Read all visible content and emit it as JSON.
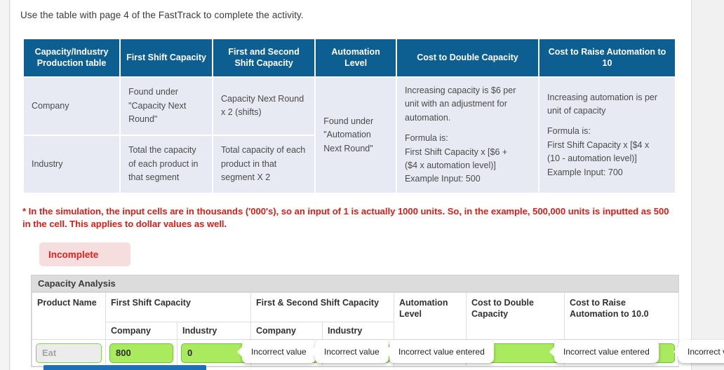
{
  "intro": "Use the table with page 4 of the FastTrack to complete the activity.",
  "reference_table": {
    "headers": [
      "Capacity/Industry Production table",
      "First Shift Capacity",
      "First and Second Shift Capacity",
      "Automation Level",
      "Cost to Double Capacity",
      "Cost to Raise Automation to 10"
    ],
    "rows": [
      {
        "label": "Company",
        "first_shift": "Found under \"Capacity Next Round\"",
        "first_second_shift": "Capacity Next Round x 2 (shifts)",
        "automation": "Found under \"Automation Next Round\"",
        "cost_double_intro": "Increasing capacity is $6 per unit with an adjustment for automation.",
        "cost_double_formula_label": "Formula is:",
        "cost_double_formula_l1": "First Shift Capacity x [$6  +",
        "cost_double_formula_l2": "($4 x automation level)]",
        "cost_double_example": "Example Input: 500",
        "cost_auto_intro": "Increasing automation is per unit of capacity",
        "cost_auto_formula_label": "Formula is:",
        "cost_auto_formula_l1": "First Shift Capacity x [$4 x",
        "cost_auto_formula_l2": "(10 - automation level)]",
        "cost_auto_example": "Example Input: 700"
      },
      {
        "label": "Industry",
        "first_shift": "Total the capacity of each product in that segment",
        "first_second_shift": "Total capacity of each product in that segment X 2"
      }
    ]
  },
  "note": "* In the simulation, the input cells are in thousands ('000's), so an input of 1 is actually 1000 units. So, in the example, 500,000 units is inputted as 500 in the cell. This applies to dollar values as well.",
  "status_badge": {
    "label": "Incomplete",
    "text_color": "#e0211b",
    "background_color": "#f7dede"
  },
  "analysis": {
    "title": "Capacity Analysis",
    "header_row_1": [
      "Product Name",
      "First Shift Capacity",
      "First & Second Shift Capacity",
      "Automation Level",
      "Cost to Double Capacity",
      "Cost to Raise Automation to 10.0"
    ],
    "header_row_2": {
      "product_name": "",
      "first_shift_company": "Company",
      "first_shift_industry": "Industry",
      "first_second_company": "Company",
      "first_second_industry": "Industry",
      "automation": "",
      "cost_double": "",
      "cost_raise": ""
    },
    "data_row": {
      "product_name": "Eat",
      "first_shift_company": "800",
      "first_shift_industry": "0",
      "first_second_company": "",
      "first_second_industry": "",
      "automation": "",
      "cost_double": "",
      "cost_raise": ""
    },
    "tooltips": [
      "Incorrect value",
      "Incorrect value",
      "Incorrect value entered",
      "Incorrect value entered",
      "Incorrect value entered"
    ]
  },
  "colors": {
    "header_blue": "#0e5f91",
    "cell_blue_grey": "#e7eaf2",
    "input_green": "#a9ea5f",
    "input_green_border": "#76c043",
    "note_red": "#e01b15",
    "accent_blue": "#1d6fb8"
  }
}
